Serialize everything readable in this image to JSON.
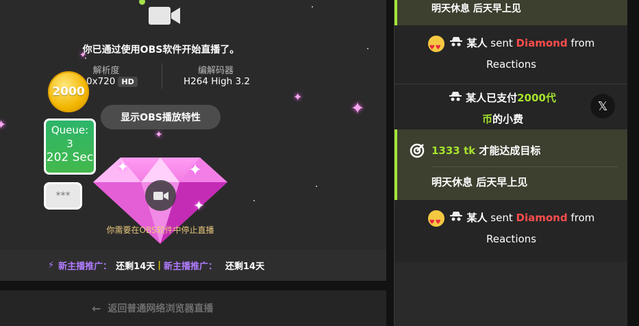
{
  "stream": {
    "obs_message": "你已通过使用OBS软件开始直播了。",
    "resolution_label": "解析度",
    "resolution_value": "0x720",
    "hd_badge": "HD",
    "codec_label": "编解码器",
    "codec_value": "H264 High 3.2",
    "obs_button": "显示OBS播放特性",
    "coin_value": "2000",
    "queue_label": "Queue:",
    "queue_count": "3",
    "queue_time": "202 Sec",
    "stars_box": "***",
    "stop_message": "你需要在OBS软件中停止直播",
    "promo_label_1": "新主播推广：",
    "promo_value_1": "还剩14天",
    "promo_label_2": "新主播推广：",
    "promo_value_2": "还剩14天",
    "back_label": "返回普通网络浏览器直播"
  },
  "chat": {
    "top_goal_text": "明天休息 后天早上见",
    "msg1": {
      "user": "某人",
      "verb": "sent",
      "item": "Diamond",
      "from": "from",
      "source": "Reactions"
    },
    "tip": {
      "user": "某人已支付",
      "amount": "2000代",
      "amount2": "币",
      "suffix": "的小费"
    },
    "goal": {
      "amount": "1333 tk",
      "text": "才能达成目标",
      "subtext": "明天休息 后天早上见"
    },
    "msg2": {
      "user": "某人",
      "verb": "sent",
      "item": "Diamond",
      "from": "from",
      "source": "Reactions"
    }
  },
  "colors": {
    "accent_green": "#a3e636",
    "diamond_red": "#ff4d4d",
    "promo_purple": "#b07cff"
  }
}
